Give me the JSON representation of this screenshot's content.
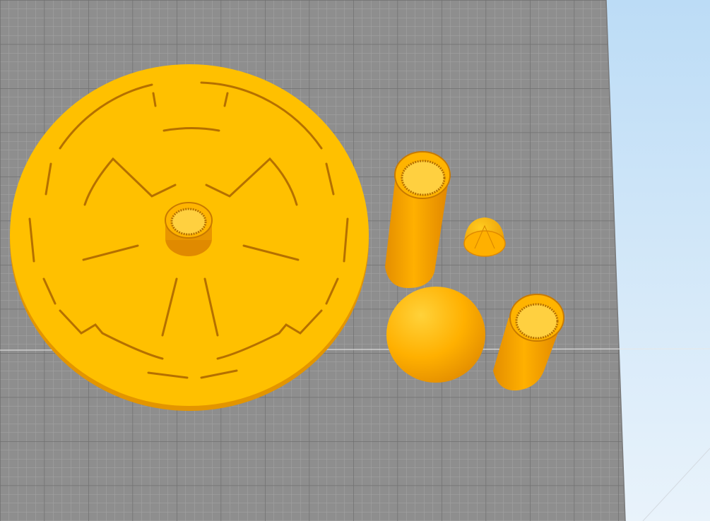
{
  "viewport": {
    "background_color": "#cfe6f8",
    "build_plate_color": "#8e8e8e",
    "grid_major_color": "#6f6f6f",
    "grid_minor_color": "#a5a5a5",
    "horizon_line_color": "#e8e8e8"
  },
  "model": {
    "color": "#ffc000",
    "shade_color": "#e89a00",
    "dark_color": "#b87400",
    "parts": [
      {
        "name": "disc-base",
        "kind": "disc",
        "hole_count": 1
      },
      {
        "name": "tall-threaded-tube",
        "kind": "tube"
      },
      {
        "name": "small-dome-cap",
        "kind": "dome"
      },
      {
        "name": "sphere",
        "kind": "sphere"
      },
      {
        "name": "short-threaded-tube",
        "kind": "tube"
      }
    ]
  }
}
